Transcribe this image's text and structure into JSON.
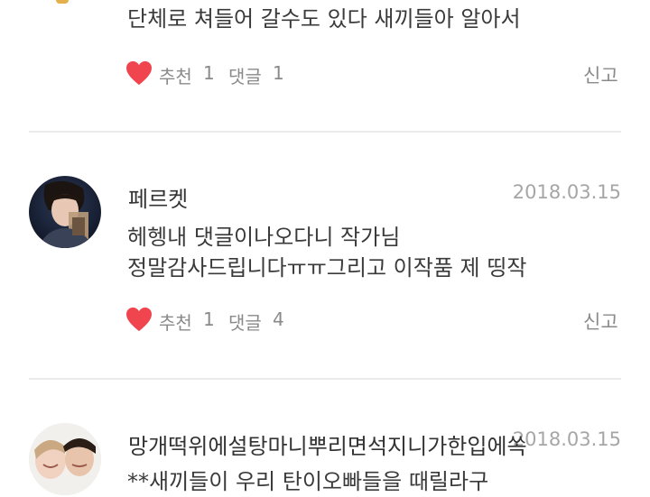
{
  "comments": [
    {
      "text_lines": [
        "단체로 쳐들어 갈수도 있다  새끼들아 알아서"
      ],
      "like_label": "추천",
      "like_count": "1",
      "reply_label": "댓글",
      "reply_count": "1",
      "report_label": "신고"
    },
    {
      "nickname": "페르켓",
      "date": "2018.03.15",
      "avatar_icon": "profile-photo",
      "text_lines": [
        "헤헹내 댓글이나오다니 작가님",
        "정말감사드립니다ㅠㅠ그리고 이작품 제 띵작"
      ],
      "like_label": "추천",
      "like_count": "1",
      "reply_label": "댓글",
      "reply_count": "4",
      "report_label": "신고"
    },
    {
      "nickname": "망개떡위에설탕마니뿌리면석지니가한입에쏙",
      "date": "2018.03.15",
      "avatar_icon": "profile-photo",
      "text_lines": [
        "**새끼들이 우리 탄이오빠들을 때릴라구"
      ]
    }
  ],
  "colors": {
    "heart": "#f0454f",
    "divider": "#ebebeb",
    "date": "#a6a6a6",
    "meta": "#8a8a8a"
  },
  "icons": {
    "like": "heart-icon"
  }
}
